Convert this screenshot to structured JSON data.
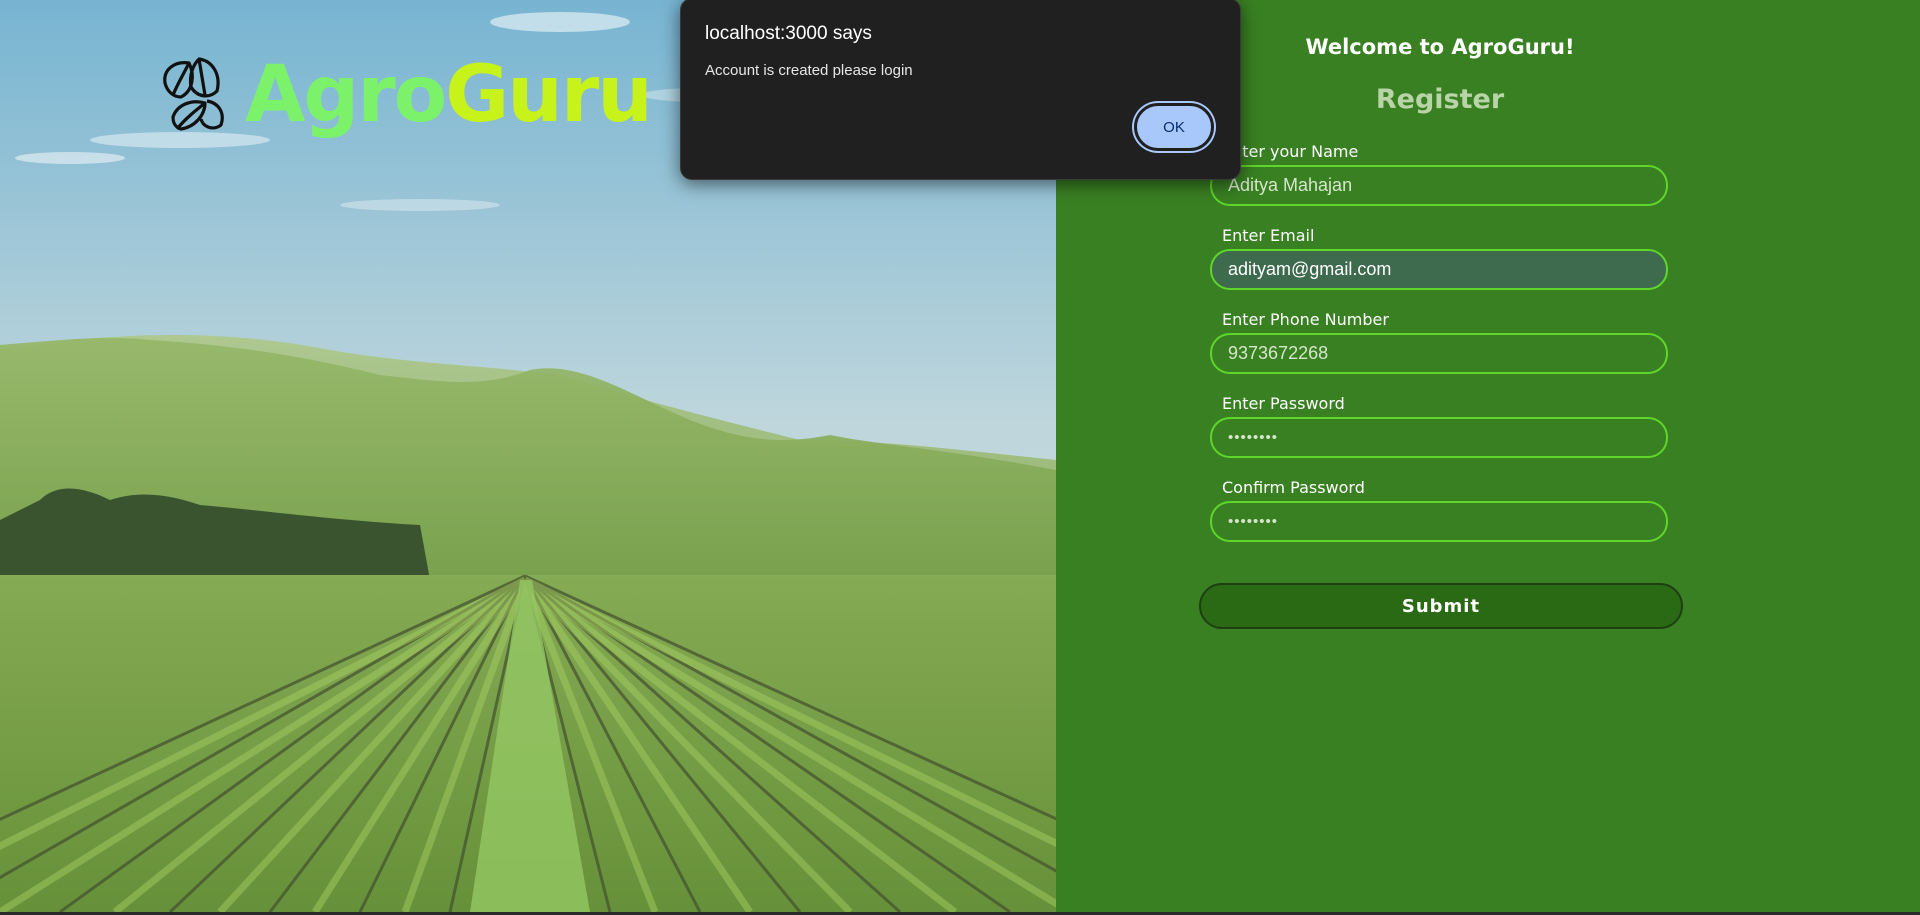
{
  "brand": {
    "part1": "Agro",
    "part2": "Guru",
    "icon": "leaf-icon",
    "colors": {
      "agro": "#7cf26b",
      "guru": "#c7f21a"
    }
  },
  "form": {
    "welcome": "Welcome to AgroGuru!",
    "title": "Register",
    "fields": [
      {
        "label": "Enter your Name",
        "value": "Aditya Mahajan"
      },
      {
        "label": "Enter Email",
        "value": "adityam@gmail.com"
      },
      {
        "label": "Enter Phone Number",
        "value": "9373672268"
      },
      {
        "label": "Enter Password",
        "value": "••••••••"
      },
      {
        "label": "Confirm Password",
        "value": "••••••••"
      }
    ],
    "submit_label": "Submit",
    "colors": {
      "panel": "#398022",
      "border": "#5ed62c",
      "button": "#2b6a15"
    }
  },
  "alert": {
    "title": "localhost:3000 says",
    "message": "Account is created please login",
    "ok_label": "OK"
  }
}
